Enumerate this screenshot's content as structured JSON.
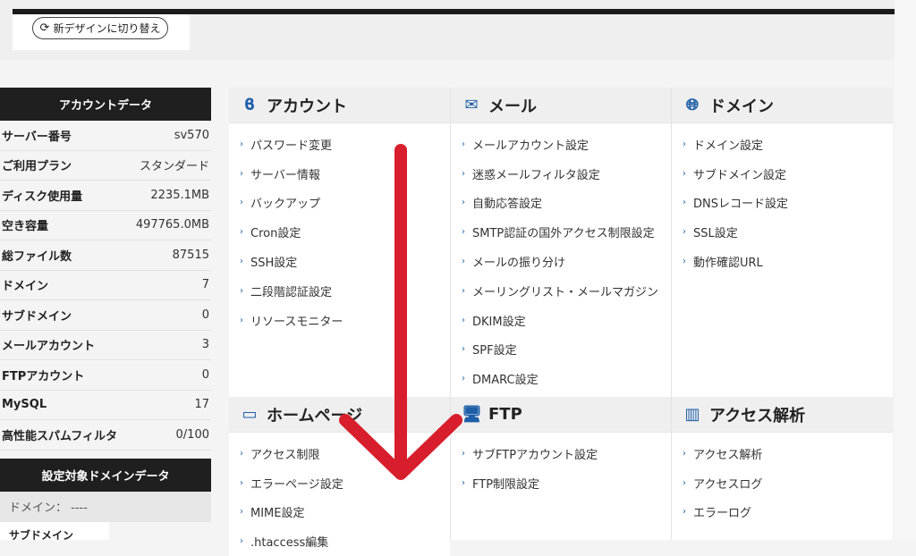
{
  "switch_button": {
    "label": "新デザインに切り替え"
  },
  "account_data": {
    "title": "アカウントデータ",
    "rows": [
      {
        "label": "サーバー番号",
        "value": "sv570"
      },
      {
        "label": "ご利用プラン",
        "value": "スタンダード"
      },
      {
        "label": "ディスク使用量",
        "value": "2235.1MB"
      },
      {
        "label": "空き容量",
        "value": "497765.0MB"
      },
      {
        "label": "総ファイル数",
        "value": "87515"
      },
      {
        "label": "ドメイン",
        "value": "7"
      },
      {
        "label": "サブドメイン",
        "value": "0"
      },
      {
        "label": "メールアカウント",
        "value": "3"
      },
      {
        "label": "FTPアカウント",
        "value": "0"
      },
      {
        "label": "MySQL",
        "value": "17"
      },
      {
        "label": "高性能スパムフィルタ",
        "value": "0/100"
      }
    ]
  },
  "domain_data": {
    "title": "設定対象ドメインデータ",
    "domain_label": "ドメイン： ----",
    "subdomain_label": "サブドメイン"
  },
  "panels": {
    "account": {
      "title": "アカウント",
      "items": [
        "パスワード変更",
        "サーバー情報",
        "バックアップ",
        "Cron設定",
        "SSH設定",
        "二段階認証設定",
        "リソースモニター"
      ]
    },
    "mail": {
      "title": "メール",
      "items": [
        "メールアカウント設定",
        "迷惑メールフィルタ設定",
        "自動応答設定",
        "SMTP認証の国外アクセス制限設定",
        "メールの振り分け",
        "メーリングリスト・メールマガジン",
        "DKIM設定",
        "SPF設定",
        "DMARC設定"
      ]
    },
    "domain": {
      "title": "ドメイン",
      "items": [
        "ドメイン設定",
        "サブドメイン設定",
        "DNSレコード設定",
        "SSL設定",
        "動作確認URL"
      ]
    },
    "homepage": {
      "title": "ホームページ",
      "items": [
        "アクセス制限",
        "エラーページ設定",
        "MIME設定",
        ".htaccess編集"
      ]
    },
    "ftp": {
      "title": "FTP",
      "items": [
        "サブFTPアカウント設定",
        "FTP制限設定"
      ]
    },
    "access": {
      "title": "アクセス解析",
      "items": [
        "アクセス解析",
        "アクセスログ",
        "エラーログ"
      ]
    }
  },
  "colors": {
    "accent": "#1e5fa8",
    "annotation_arrow": "#d81e2c"
  }
}
